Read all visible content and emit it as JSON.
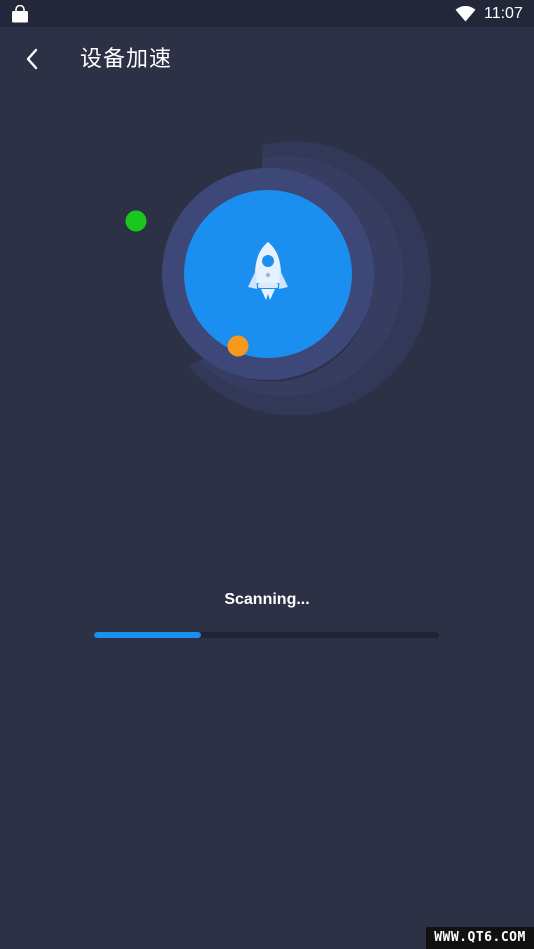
{
  "status_bar": {
    "time": "11:07",
    "left_icon": "shopping-bag-icon",
    "right_icons": [
      "wifi-icon"
    ]
  },
  "header": {
    "back_icon": "back-arrow-icon",
    "title": "设备加速"
  },
  "scan": {
    "center_icon": "rocket-icon",
    "status_text": "Scanning...",
    "progress": 0.31
  },
  "watermark": "WWW.QT6.COM",
  "colors": {
    "background": "#2c3146",
    "accent": "#1a8ff0",
    "ring": "#3e4878",
    "green_dot": "#19c71f",
    "orange_dot": "#f59a1f"
  }
}
